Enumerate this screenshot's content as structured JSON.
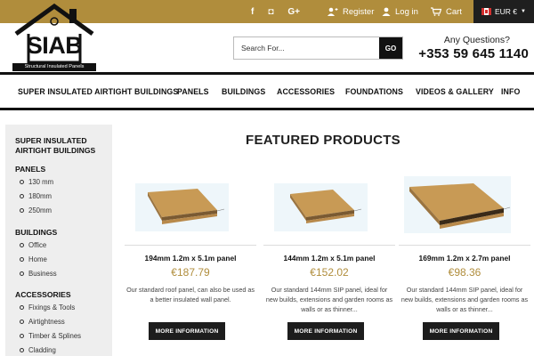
{
  "topbar": {
    "social": [
      {
        "icon": "facebook-icon",
        "glyph": "f"
      },
      {
        "icon": "instagram-icon",
        "glyph": "◘"
      },
      {
        "icon": "google-plus-icon",
        "glyph": "G+"
      }
    ],
    "register_label": "Register",
    "login_label": "Log in",
    "cart_label": "Cart",
    "currency_label": "EUR €",
    "accent_color": "#b08d3c",
    "dark_color": "#1f1f1f"
  },
  "logo": {
    "text": "SIAB",
    "subtext": "Structural Insulated Panels"
  },
  "search": {
    "placeholder": "Search For...",
    "button_label": "GO"
  },
  "contact": {
    "question": "Any Questions?",
    "phone": "+353 59 645 1140"
  },
  "nav": {
    "items": [
      "SUPER INSULATED AIRTIGHT BUILDINGS",
      "PANELS",
      "BUILDINGS",
      "ACCESSORIES",
      "FOUNDATIONS",
      "VIDEOS & GALLERY",
      "INFO"
    ]
  },
  "sidebar": {
    "sections": [
      {
        "heading": "SUPER INSULATED AIRTIGHT BUILDINGS",
        "items": []
      },
      {
        "heading": "PANELS",
        "items": [
          "130 mm",
          "180mm",
          "250mm"
        ]
      },
      {
        "heading": "BUILDINGS",
        "items": [
          "Office",
          "Home",
          "Business"
        ]
      },
      {
        "heading": "ACCESSORIES",
        "items": [
          "Fixings & Tools",
          "Airtightness",
          "Timber & Splines",
          "Cladding"
        ]
      }
    ]
  },
  "featured": {
    "title": "FEATURED PRODUCTS",
    "products": [
      {
        "name": "194mm 1.2m x 5.1m panel",
        "price": "€187.79",
        "description": "Our standard roof panel, can also be used as a better insulated wall panel.",
        "button_label": "MORE INFORMATION"
      },
      {
        "name": "144mm 1.2m x 5.1m panel",
        "price": "€152.02",
        "description": "Our standard 144mm SIP panel, ideal for new builds, extensions and garden rooms as walls or as thinner...",
        "button_label": "MORE INFORMATION"
      },
      {
        "name": "169mm 1.2m x 2.7m panel",
        "price": "€98.36",
        "description": "Our standard 144mm SIP panel, ideal for new builds, extensions and garden rooms as walls or as thinner...",
        "button_label": "MORE INFORMATION"
      }
    ]
  }
}
